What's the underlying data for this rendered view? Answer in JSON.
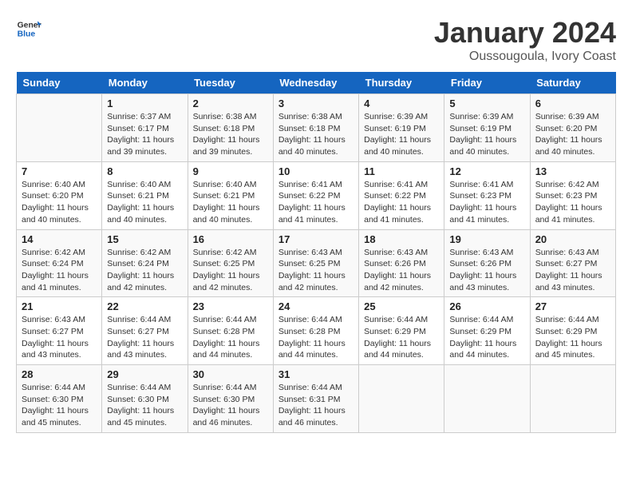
{
  "header": {
    "logo_line1": "General",
    "logo_line2": "Blue",
    "title": "January 2024",
    "subtitle": "Oussougoula, Ivory Coast"
  },
  "days_of_week": [
    "Sunday",
    "Monday",
    "Tuesday",
    "Wednesday",
    "Thursday",
    "Friday",
    "Saturday"
  ],
  "weeks": [
    [
      {
        "day": "",
        "info": ""
      },
      {
        "day": "1",
        "info": "Sunrise: 6:37 AM\nSunset: 6:17 PM\nDaylight: 11 hours\nand 39 minutes."
      },
      {
        "day": "2",
        "info": "Sunrise: 6:38 AM\nSunset: 6:18 PM\nDaylight: 11 hours\nand 39 minutes."
      },
      {
        "day": "3",
        "info": "Sunrise: 6:38 AM\nSunset: 6:18 PM\nDaylight: 11 hours\nand 40 minutes."
      },
      {
        "day": "4",
        "info": "Sunrise: 6:39 AM\nSunset: 6:19 PM\nDaylight: 11 hours\nand 40 minutes."
      },
      {
        "day": "5",
        "info": "Sunrise: 6:39 AM\nSunset: 6:19 PM\nDaylight: 11 hours\nand 40 minutes."
      },
      {
        "day": "6",
        "info": "Sunrise: 6:39 AM\nSunset: 6:20 PM\nDaylight: 11 hours\nand 40 minutes."
      }
    ],
    [
      {
        "day": "7",
        "info": "Sunrise: 6:40 AM\nSunset: 6:20 PM\nDaylight: 11 hours\nand 40 minutes."
      },
      {
        "day": "8",
        "info": "Sunrise: 6:40 AM\nSunset: 6:21 PM\nDaylight: 11 hours\nand 40 minutes."
      },
      {
        "day": "9",
        "info": "Sunrise: 6:40 AM\nSunset: 6:21 PM\nDaylight: 11 hours\nand 40 minutes."
      },
      {
        "day": "10",
        "info": "Sunrise: 6:41 AM\nSunset: 6:22 PM\nDaylight: 11 hours\nand 41 minutes."
      },
      {
        "day": "11",
        "info": "Sunrise: 6:41 AM\nSunset: 6:22 PM\nDaylight: 11 hours\nand 41 minutes."
      },
      {
        "day": "12",
        "info": "Sunrise: 6:41 AM\nSunset: 6:23 PM\nDaylight: 11 hours\nand 41 minutes."
      },
      {
        "day": "13",
        "info": "Sunrise: 6:42 AM\nSunset: 6:23 PM\nDaylight: 11 hours\nand 41 minutes."
      }
    ],
    [
      {
        "day": "14",
        "info": "Sunrise: 6:42 AM\nSunset: 6:24 PM\nDaylight: 11 hours\nand 41 minutes."
      },
      {
        "day": "15",
        "info": "Sunrise: 6:42 AM\nSunset: 6:24 PM\nDaylight: 11 hours\nand 42 minutes."
      },
      {
        "day": "16",
        "info": "Sunrise: 6:42 AM\nSunset: 6:25 PM\nDaylight: 11 hours\nand 42 minutes."
      },
      {
        "day": "17",
        "info": "Sunrise: 6:43 AM\nSunset: 6:25 PM\nDaylight: 11 hours\nand 42 minutes."
      },
      {
        "day": "18",
        "info": "Sunrise: 6:43 AM\nSunset: 6:26 PM\nDaylight: 11 hours\nand 42 minutes."
      },
      {
        "day": "19",
        "info": "Sunrise: 6:43 AM\nSunset: 6:26 PM\nDaylight: 11 hours\nand 43 minutes."
      },
      {
        "day": "20",
        "info": "Sunrise: 6:43 AM\nSunset: 6:27 PM\nDaylight: 11 hours\nand 43 minutes."
      }
    ],
    [
      {
        "day": "21",
        "info": "Sunrise: 6:43 AM\nSunset: 6:27 PM\nDaylight: 11 hours\nand 43 minutes."
      },
      {
        "day": "22",
        "info": "Sunrise: 6:44 AM\nSunset: 6:27 PM\nDaylight: 11 hours\nand 43 minutes."
      },
      {
        "day": "23",
        "info": "Sunrise: 6:44 AM\nSunset: 6:28 PM\nDaylight: 11 hours\nand 44 minutes."
      },
      {
        "day": "24",
        "info": "Sunrise: 6:44 AM\nSunset: 6:28 PM\nDaylight: 11 hours\nand 44 minutes."
      },
      {
        "day": "25",
        "info": "Sunrise: 6:44 AM\nSunset: 6:29 PM\nDaylight: 11 hours\nand 44 minutes."
      },
      {
        "day": "26",
        "info": "Sunrise: 6:44 AM\nSunset: 6:29 PM\nDaylight: 11 hours\nand 44 minutes."
      },
      {
        "day": "27",
        "info": "Sunrise: 6:44 AM\nSunset: 6:29 PM\nDaylight: 11 hours\nand 45 minutes."
      }
    ],
    [
      {
        "day": "28",
        "info": "Sunrise: 6:44 AM\nSunset: 6:30 PM\nDaylight: 11 hours\nand 45 minutes."
      },
      {
        "day": "29",
        "info": "Sunrise: 6:44 AM\nSunset: 6:30 PM\nDaylight: 11 hours\nand 45 minutes."
      },
      {
        "day": "30",
        "info": "Sunrise: 6:44 AM\nSunset: 6:30 PM\nDaylight: 11 hours\nand 46 minutes."
      },
      {
        "day": "31",
        "info": "Sunrise: 6:44 AM\nSunset: 6:31 PM\nDaylight: 11 hours\nand 46 minutes."
      },
      {
        "day": "",
        "info": ""
      },
      {
        "day": "",
        "info": ""
      },
      {
        "day": "",
        "info": ""
      }
    ]
  ]
}
